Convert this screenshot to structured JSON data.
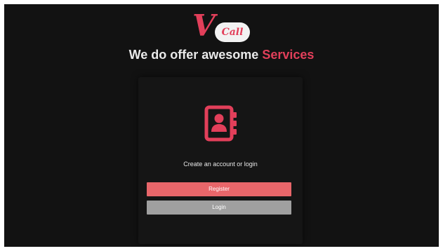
{
  "logo": {
    "letter": "V",
    "word": "Call"
  },
  "headline": {
    "text": "We do offer awesome",
    "accent": "Services"
  },
  "card": {
    "icon": "contact-book-icon",
    "prompt": "Create an account or login",
    "register_label": "Register",
    "login_label": "Login"
  },
  "colors": {
    "accent": "#e23f5a",
    "register_button": "#e8666a",
    "login_button": "#a0a0a0",
    "background": "#121212"
  }
}
